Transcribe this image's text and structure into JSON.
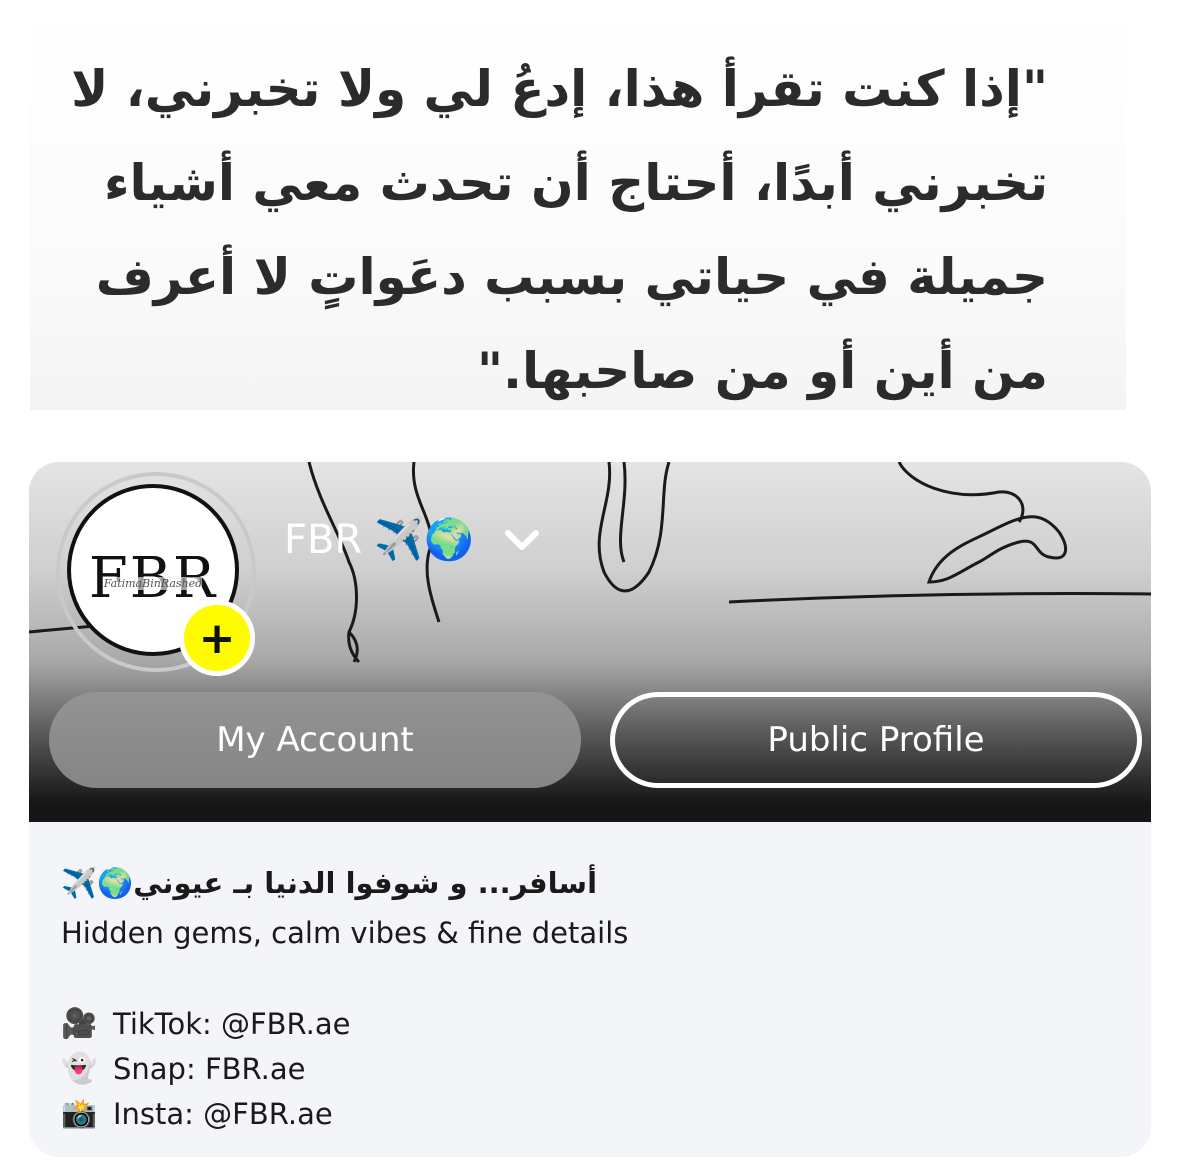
{
  "quote": {
    "text": "\"إذا كنت تقرأ هذا، إدعُ لي ولا تخبرني، لا تخبرني أبدًا، أحتاج أن تحدث معي أشياء جميلة في حياتي بسبب دعَواتٍ لا أعرف من أين أو من صاحبها.\""
  },
  "profile": {
    "avatar_logo": "FBR",
    "avatar_script": "FatimaBinRashed",
    "add_symbol": "+",
    "display_name": "FBR",
    "name_emoji": "✈️🌍",
    "buttons": {
      "my_account": "My Account",
      "public_profile": "Public Profile"
    }
  },
  "bio": {
    "arabic_line": "✈️🌍أسافر... و شوفوا الدنيا بـ عيوني",
    "english_line": "Hidden gems, calm vibes & fine details",
    "socials": [
      {
        "icon": "🎥",
        "icon_name": "video-camera-icon",
        "text": "TikTok: @FBR.ae"
      },
      {
        "icon": "👻",
        "icon_name": "ghost-icon",
        "text": "Snap: FBR.ae"
      },
      {
        "icon": "📸",
        "icon_name": "camera-flash-icon",
        "text": "Insta: @FBR.ae"
      }
    ]
  },
  "colors": {
    "snap_yellow": "#fffc00",
    "bio_bg": "#f4f5f8",
    "text": "#1a1a1a"
  }
}
